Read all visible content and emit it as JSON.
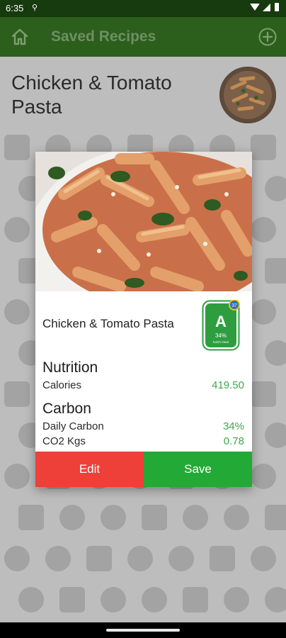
{
  "status_bar": {
    "time": "6:35",
    "usb_glyph": "⚲"
  },
  "app_bar": {
    "title": "Saved Recipes"
  },
  "page": {
    "recipe_title": "Chicken & Tomato Pasta"
  },
  "dialog": {
    "title": "Chicken & Tomato Pasta",
    "badge": {
      "grade": "A",
      "percent": "34%",
      "caption": "lunch meal",
      "dot_value": "37"
    },
    "nutrition": {
      "heading": "Nutrition",
      "rows": [
        {
          "label": "Calories",
          "value": "419.50"
        }
      ]
    },
    "carbon": {
      "heading": "Carbon",
      "rows": [
        {
          "label": "Daily Carbon",
          "value": "34%"
        },
        {
          "label": "CO2 Kgs",
          "value": "0.78"
        }
      ]
    },
    "edit_label": "Edit",
    "save_label": "Save"
  },
  "colors": {
    "app_bar": "#2c5e1c",
    "status_bar": "#173a0e",
    "edit": "#ee4038",
    "save": "#23a936",
    "value": "#3ea84c",
    "badge": "#2e9d40"
  },
  "icons": [
    "home-icon",
    "add-circle-icon",
    "wifi-icon",
    "signal-icon",
    "battery-icon",
    "usb-icon"
  ]
}
